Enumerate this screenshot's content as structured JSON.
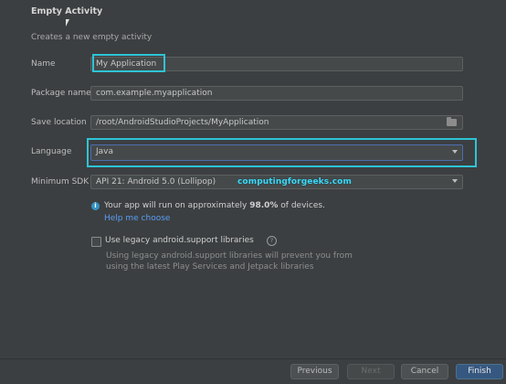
{
  "header": {
    "title": "Empty Activity",
    "subtitle": "Creates a new empty activity"
  },
  "form": {
    "name_label": "Name",
    "name_value": "My Application",
    "package_label": "Package name",
    "package_value": "com.example.myapplication",
    "save_label": "Save location",
    "save_value": "/root/AndroidStudioProjects/MyApplication",
    "language_label": "Language",
    "language_value": "Java",
    "sdk_label": "Minimum SDK",
    "sdk_value": "API 21: Android 5.0 (Lollipop)"
  },
  "info": {
    "icon": "info-icon",
    "text_prefix": "Your app will run on approximately ",
    "percent": "98.0%",
    "text_suffix": " of devices.",
    "help_link": "Help me choose"
  },
  "legacy": {
    "checked": false,
    "label": "Use legacy android.support libraries",
    "help_icon": "?",
    "description": "Using legacy android.support libraries will prevent you from using the latest Play Services and Jetpack libraries"
  },
  "watermark": "computingforgeeks.com",
  "footer": {
    "previous": "Previous",
    "next": "Next",
    "cancel": "Cancel",
    "finish": "Finish"
  },
  "colors": {
    "background": "#3c3f41",
    "highlight": "#2ec4d6",
    "link": "#589df6",
    "primary_button": "#365880"
  }
}
